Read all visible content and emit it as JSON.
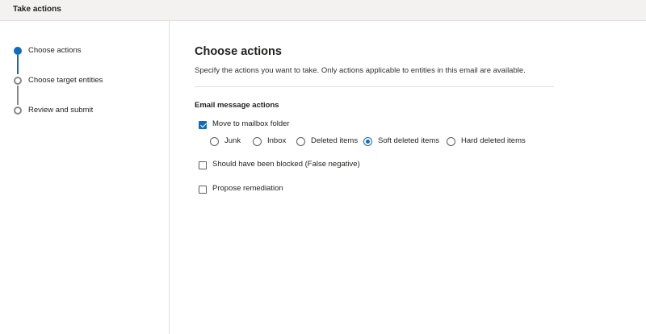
{
  "window": {
    "title": "Take actions"
  },
  "steps": [
    {
      "label": "Choose actions",
      "state": "active"
    },
    {
      "label": "Choose target entities",
      "state": "pending"
    },
    {
      "label": "Review and submit",
      "state": "pending"
    }
  ],
  "main": {
    "title": "Choose actions",
    "description": "Specify the actions you want to take. Only actions applicable to entities in this email are available.",
    "section_heading": "Email message actions",
    "actions": [
      {
        "label": "Move to mailbox folder",
        "checked": true
      },
      {
        "label": "Should have been blocked (False negative)",
        "checked": false
      },
      {
        "label": "Propose remediation",
        "checked": false
      }
    ],
    "folder_options": [
      {
        "label": "Junk",
        "selected": false
      },
      {
        "label": "Inbox",
        "selected": false
      },
      {
        "label": "Deleted items",
        "selected": false
      },
      {
        "label": "Soft deleted items",
        "selected": true
      },
      {
        "label": "Hard deleted items",
        "selected": false
      }
    ]
  },
  "colors": {
    "accent": "#0f6cbd",
    "pending_step": "#8a8886",
    "divider": "#e1dfdd"
  }
}
